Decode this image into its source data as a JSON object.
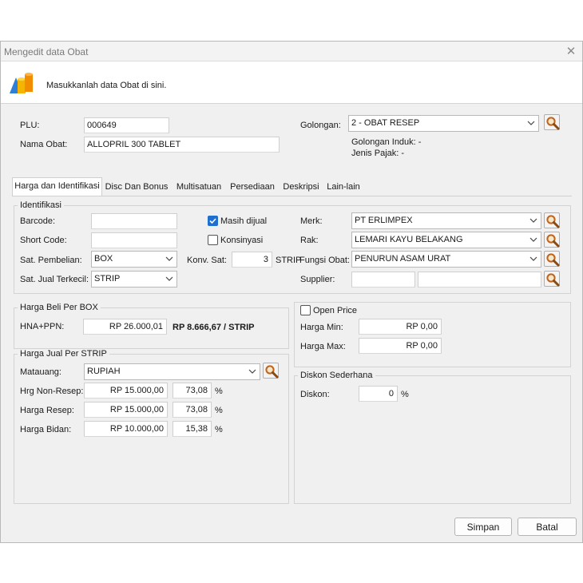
{
  "window": {
    "title": "Mengedit data Obat",
    "close_glyph": "✕"
  },
  "header": {
    "instruction": "Masukkanlah data Obat di sini.",
    "icon": "shapes-icon"
  },
  "top": {
    "plu_label": "PLU:",
    "plu_value": "000649",
    "nama_label": "Nama Obat:",
    "nama_value": "ALLOPRIL 300 TABLET",
    "golongan_label": "Golongan:",
    "golongan_value": "2 - OBAT RESEP",
    "golongan_induk": "Golongan Induk: -",
    "jenis_pajak": "Jenis Pajak: -"
  },
  "tabs": [
    "Harga dan Identifikasi",
    "Disc Dan Bonus",
    "Multisatuan",
    "Persediaan",
    "Deskripsi",
    "Lain-lain"
  ],
  "identifikasi": {
    "caption": "Identifikasi",
    "barcode_label": "Barcode:",
    "barcode_value": "",
    "shortcode_label": "Short Code:",
    "shortcode_value": "",
    "sat_pembelian_label": "Sat. Pembelian:",
    "sat_pembelian_value": "BOX",
    "sat_jual_label": "Sat. Jual Terkecil:",
    "sat_jual_value": "STRIP",
    "masih_dijual_label": "Masih dijual",
    "masih_dijual_checked": true,
    "konsinyasi_label": "Konsinyasi",
    "konsinyasi_checked": false,
    "konv_label": "Konv. Sat:",
    "konv_value": "3",
    "konv_unit": "STRIP",
    "merk_label": "Merk:",
    "merk_value": "PT ERLIMPEX",
    "rak_label": "Rak:",
    "rak_value": "LEMARI KAYU BELAKANG",
    "fungsi_label": "Fungsi Obat:",
    "fungsi_value": "PENURUN ASAM URAT",
    "supplier_label": "Supplier:",
    "supplier_code": "",
    "supplier_name": ""
  },
  "harga_beli": {
    "caption": "Harga Beli Per BOX",
    "hna_label": "HNA+PPN:",
    "hna_value": "RP 26.000,01",
    "per_unit": "RP 8.666,67 / STRIP"
  },
  "open_price": {
    "label": "Open Price",
    "checked": false,
    "min_label": "Harga Min:",
    "min_value": "RP 0,00",
    "max_label": "Harga Max:",
    "max_value": "RP 0,00"
  },
  "harga_jual": {
    "caption": "Harga Jual Per STRIP",
    "matauang_label": "Matauang:",
    "matauang_value": "RUPIAH",
    "rows": [
      {
        "label": "Hrg Non-Resep:",
        "value": "RP 15.000,00",
        "pct": "73,08",
        "unit": "%"
      },
      {
        "label": "Harga Resep:",
        "value": "RP 15.000,00",
        "pct": "73,08",
        "unit": "%"
      },
      {
        "label": "Harga Bidan:",
        "value": "RP 10.000,00",
        "pct": "15,38",
        "unit": "%"
      }
    ]
  },
  "diskon": {
    "caption": "Diskon Sederhana",
    "label": "Diskon:",
    "value": "0",
    "unit": "%"
  },
  "buttons": {
    "save": "Simpan",
    "cancel": "Batal"
  },
  "colors": {
    "accent": "#1f6fd0",
    "window_bg": "#f0f0f0",
    "search_icon": "#c0641c"
  }
}
